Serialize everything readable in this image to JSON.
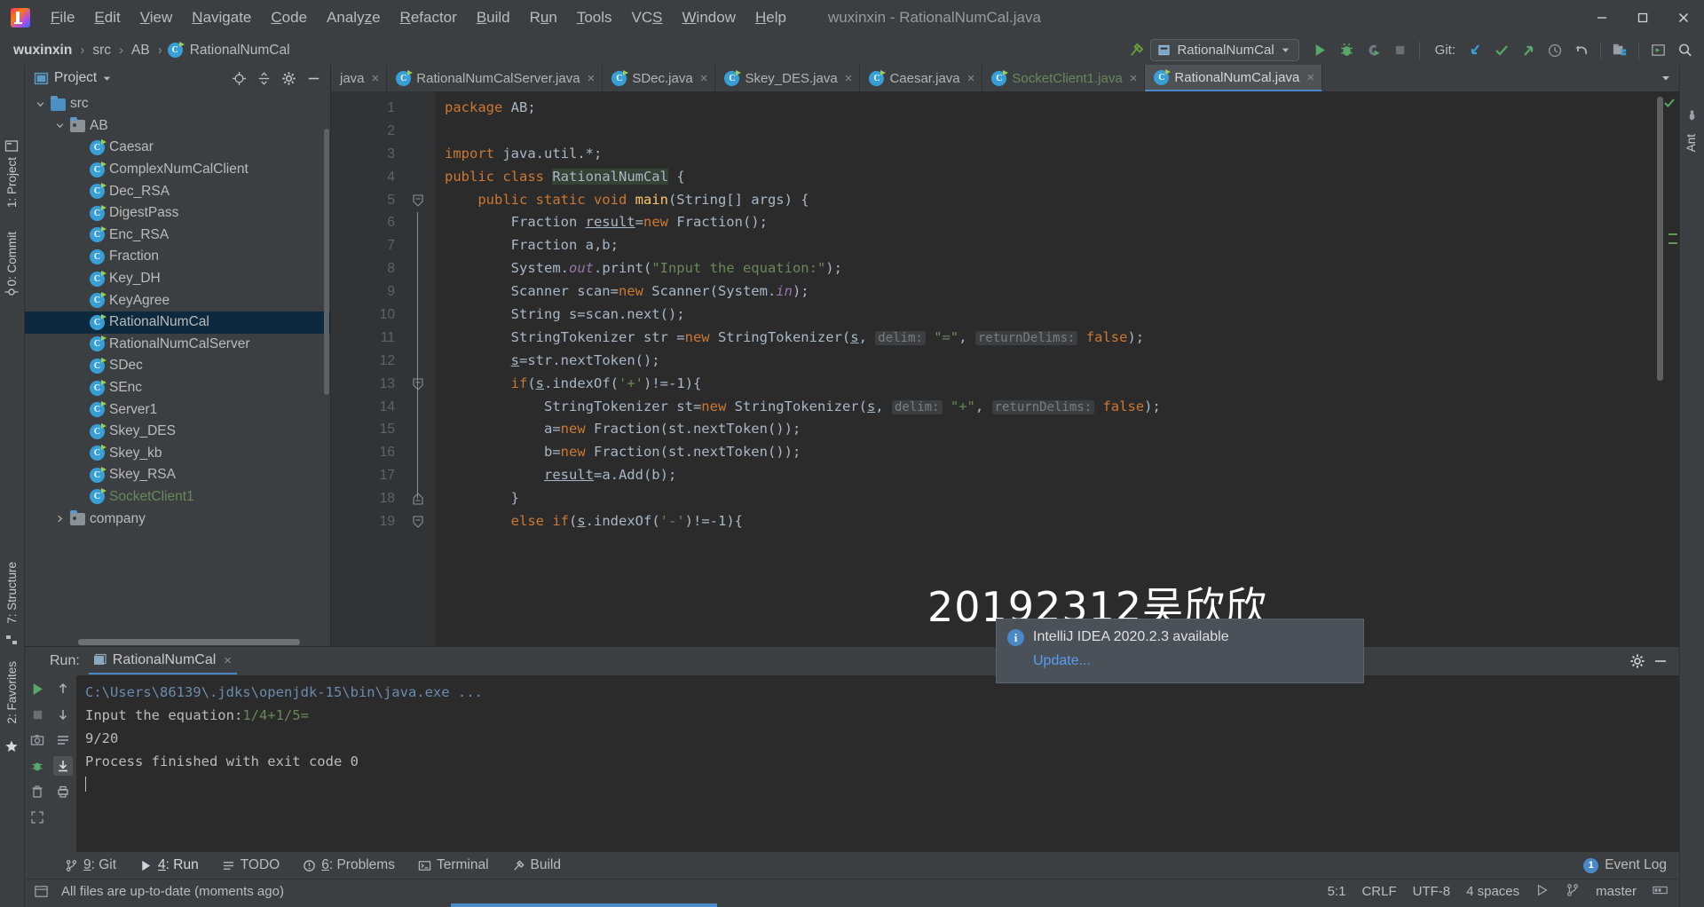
{
  "window": {
    "title": "wuxinxin - RationalNumCal.java",
    "logo": "intellij-idea-logo",
    "controls": {
      "minimize": "minimize-icon",
      "maximize": "maximize-icon",
      "close": "close-icon"
    }
  },
  "menubar": {
    "items": [
      {
        "label": "File",
        "accel": "F"
      },
      {
        "label": "Edit",
        "accel": "E"
      },
      {
        "label": "View",
        "accel": "V"
      },
      {
        "label": "Navigate",
        "accel": "N"
      },
      {
        "label": "Code",
        "accel": "C"
      },
      {
        "label": "Analyze",
        "accel": "z"
      },
      {
        "label": "Refactor",
        "accel": "R"
      },
      {
        "label": "Build",
        "accel": "B"
      },
      {
        "label": "Run",
        "accel": "u"
      },
      {
        "label": "Tools",
        "accel": "T"
      },
      {
        "label": "VCS",
        "accel": "S"
      },
      {
        "label": "Window",
        "accel": "W"
      },
      {
        "label": "Help",
        "accel": "H"
      }
    ]
  },
  "navbar": {
    "breadcrumbs": [
      "wuxinxin",
      "src",
      "AB",
      "RationalNumCal"
    ],
    "separator": "›",
    "run_configuration": "RationalNumCal",
    "git_label": "Git:",
    "icons": [
      "build-hammer-icon",
      "run-icon",
      "debug-icon",
      "run-with-coverage-icon",
      "stop-icon",
      "update-project-icon",
      "commit-icon",
      "push-icon",
      "history-icon",
      "rollback-icon",
      "project-structure-icon",
      "select-target-icon",
      "search-everywhere-icon"
    ]
  },
  "left_rail": {
    "items": [
      "1: Project",
      "0: Commit"
    ],
    "bottom_items": [
      "2: Favorites",
      "7: Structure"
    ]
  },
  "project_panel": {
    "title": "Project",
    "head_icons": [
      "locate-icon",
      "collapse-all-icon",
      "settings-gear-icon",
      "hide-icon"
    ],
    "tree": [
      {
        "label": "src",
        "indent": 1,
        "type": "folder-src",
        "expanded": true,
        "selected": false
      },
      {
        "label": "AB",
        "indent": 2,
        "type": "folder-pkg",
        "expanded": true,
        "selected": false
      },
      {
        "label": "Caesar",
        "indent": 3,
        "type": "class-badge",
        "selected": false
      },
      {
        "label": "ComplexNumCalClient",
        "indent": 3,
        "type": "class-badge",
        "selected": false
      },
      {
        "label": "Dec_RSA",
        "indent": 3,
        "type": "class-badge",
        "selected": false
      },
      {
        "label": "DigestPass",
        "indent": 3,
        "type": "class-badge",
        "selected": false
      },
      {
        "label": "Enc_RSA",
        "indent": 3,
        "type": "class-badge",
        "selected": false
      },
      {
        "label": "Fraction",
        "indent": 3,
        "type": "class",
        "selected": false
      },
      {
        "label": "Key_DH",
        "indent": 3,
        "type": "class-badge",
        "selected": false
      },
      {
        "label": "KeyAgree",
        "indent": 3,
        "type": "class-badge",
        "selected": false
      },
      {
        "label": "RationalNumCal",
        "indent": 3,
        "type": "class-badge",
        "selected": true
      },
      {
        "label": "RationalNumCalServer",
        "indent": 3,
        "type": "class-badge",
        "selected": false
      },
      {
        "label": "SDec",
        "indent": 3,
        "type": "class-badge",
        "selected": false
      },
      {
        "label": "SEnc",
        "indent": 3,
        "type": "class-badge",
        "selected": false
      },
      {
        "label": "Server1",
        "indent": 3,
        "type": "class-badge",
        "selected": false
      },
      {
        "label": "Skey_DES",
        "indent": 3,
        "type": "class-badge",
        "selected": false
      },
      {
        "label": "Skey_kb",
        "indent": 3,
        "type": "class-badge",
        "selected": false
      },
      {
        "label": "Skey_RSA",
        "indent": 3,
        "type": "class-badge",
        "selected": false
      },
      {
        "label": "SocketClient1",
        "indent": 3,
        "type": "class-badge",
        "selected": false,
        "green": true
      },
      {
        "label": "company",
        "indent": 2,
        "type": "folder-pkg",
        "expanded": false,
        "selected": false
      }
    ]
  },
  "editor": {
    "tabs": [
      {
        "label": "java",
        "icon": "none",
        "active": false,
        "green": false
      },
      {
        "label": "RationalNumCalServer.java",
        "icon": "java-class",
        "active": false,
        "green": false
      },
      {
        "label": "SDec.java",
        "icon": "java-class",
        "active": false,
        "green": false
      },
      {
        "label": "Skey_DES.java",
        "icon": "java-class",
        "active": false,
        "green": false
      },
      {
        "label": "Caesar.java",
        "icon": "java-class",
        "active": false,
        "green": false
      },
      {
        "label": "SocketClient1.java",
        "icon": "java-class",
        "active": false,
        "green": true
      },
      {
        "label": "RationalNumCal.java",
        "icon": "java-class",
        "active": true,
        "green": false
      }
    ],
    "line_numbers": [
      1,
      2,
      3,
      4,
      5,
      6,
      7,
      8,
      9,
      10,
      11,
      12,
      13,
      14,
      15,
      16,
      17,
      18,
      19
    ],
    "gutter_run_markers": [
      4,
      5
    ],
    "lines": [
      {
        "n": 1,
        "tokens": [
          {
            "t": "package ",
            "c": "kw"
          },
          {
            "t": "AB;",
            "c": ""
          }
        ]
      },
      {
        "n": 2,
        "tokens": []
      },
      {
        "n": 3,
        "tokens": [
          {
            "t": "import ",
            "c": "kw"
          },
          {
            "t": "java.util.*;",
            "c": ""
          }
        ]
      },
      {
        "n": 4,
        "tokens": [
          {
            "t": "public class ",
            "c": "kw"
          },
          {
            "t": "RationalNumCal",
            "c": "cls-hl"
          },
          {
            "t": " {",
            "c": ""
          }
        ]
      },
      {
        "n": 5,
        "tokens": [
          {
            "t": "    ",
            "c": ""
          },
          {
            "t": "public static void ",
            "c": "kw"
          },
          {
            "t": "main",
            "c": "mth"
          },
          {
            "t": "(String[] args) {",
            "c": ""
          }
        ]
      },
      {
        "n": 6,
        "tokens": [
          {
            "t": "        Fraction ",
            "c": ""
          },
          {
            "t": "result",
            "c": "und"
          },
          {
            "t": "=",
            "c": ""
          },
          {
            "t": "new ",
            "c": "kw"
          },
          {
            "t": "Fraction();",
            "c": ""
          }
        ]
      },
      {
        "n": 7,
        "tokens": [
          {
            "t": "        Fraction a,b;",
            "c": ""
          }
        ]
      },
      {
        "n": 8,
        "tokens": [
          {
            "t": "        System.",
            "c": ""
          },
          {
            "t": "out",
            "c": "fld"
          },
          {
            "t": ".print(",
            "c": ""
          },
          {
            "t": "\"Input the equation:\"",
            "c": "str"
          },
          {
            "t": ");",
            "c": ""
          }
        ]
      },
      {
        "n": 9,
        "tokens": [
          {
            "t": "        Scanner scan=",
            "c": ""
          },
          {
            "t": "new ",
            "c": "kw"
          },
          {
            "t": "Scanner(System.",
            "c": ""
          },
          {
            "t": "in",
            "c": "fld"
          },
          {
            "t": ");",
            "c": ""
          }
        ]
      },
      {
        "n": 10,
        "tokens": [
          {
            "t": "        String s=scan.next();",
            "c": ""
          }
        ]
      },
      {
        "n": 11,
        "tokens": [
          {
            "t": "        StringTokenizer str =",
            "c": ""
          },
          {
            "t": "new ",
            "c": "kw"
          },
          {
            "t": "StringTokenizer(",
            "c": ""
          },
          {
            "t": "s",
            "c": "und"
          },
          {
            "t": ", ",
            "c": ""
          },
          {
            "t": "delim:",
            "c": "hint"
          },
          {
            "t": " ",
            "c": ""
          },
          {
            "t": "\"=\"",
            "c": "str"
          },
          {
            "t": ", ",
            "c": ""
          },
          {
            "t": "returnDelims:",
            "c": "hint"
          },
          {
            "t": " ",
            "c": ""
          },
          {
            "t": "false",
            "c": "kw"
          },
          {
            "t": ");",
            "c": ""
          }
        ]
      },
      {
        "n": 12,
        "tokens": [
          {
            "t": "        ",
            "c": ""
          },
          {
            "t": "s",
            "c": "und"
          },
          {
            "t": "=str.nextToken();",
            "c": ""
          }
        ]
      },
      {
        "n": 13,
        "tokens": [
          {
            "t": "        ",
            "c": ""
          },
          {
            "t": "if",
            "c": "kw"
          },
          {
            "t": "(",
            "c": ""
          },
          {
            "t": "s",
            "c": "und"
          },
          {
            "t": ".indexOf(",
            "c": ""
          },
          {
            "t": "'+'",
            "c": "str"
          },
          {
            "t": ")!=-",
            "c": ""
          },
          {
            "t": "1",
            "c": ""
          },
          {
            "t": "){",
            "c": ""
          }
        ]
      },
      {
        "n": 14,
        "tokens": [
          {
            "t": "            StringTokenizer st=",
            "c": ""
          },
          {
            "t": "new ",
            "c": "kw"
          },
          {
            "t": "StringTokenizer(",
            "c": ""
          },
          {
            "t": "s",
            "c": "und"
          },
          {
            "t": ", ",
            "c": ""
          },
          {
            "t": "delim:",
            "c": "hint"
          },
          {
            "t": " ",
            "c": ""
          },
          {
            "t": "\"+\"",
            "c": "str"
          },
          {
            "t": ", ",
            "c": ""
          },
          {
            "t": "returnDelims:",
            "c": "hint"
          },
          {
            "t": " ",
            "c": ""
          },
          {
            "t": "false",
            "c": "kw"
          },
          {
            "t": ");",
            "c": ""
          }
        ]
      },
      {
        "n": 15,
        "tokens": [
          {
            "t": "            a=",
            "c": ""
          },
          {
            "t": "new ",
            "c": "kw"
          },
          {
            "t": "Fraction(st.nextToken());",
            "c": ""
          }
        ]
      },
      {
        "n": 16,
        "tokens": [
          {
            "t": "            b=",
            "c": ""
          },
          {
            "t": "new ",
            "c": "kw"
          },
          {
            "t": "Fraction(st.nextToken());",
            "c": ""
          }
        ]
      },
      {
        "n": 17,
        "tokens": [
          {
            "t": "            ",
            "c": ""
          },
          {
            "t": "result",
            "c": "und"
          },
          {
            "t": "=a.Add(b);",
            "c": ""
          }
        ]
      },
      {
        "n": 18,
        "tokens": [
          {
            "t": "        }",
            "c": ""
          }
        ]
      },
      {
        "n": 19,
        "tokens": [
          {
            "t": "        ",
            "c": ""
          },
          {
            "t": "else if",
            "c": "kw"
          },
          {
            "t": "(",
            "c": ""
          },
          {
            "t": "s",
            "c": "und"
          },
          {
            "t": ".indexOf(",
            "c": ""
          },
          {
            "t": "'-'",
            "c": "str"
          },
          {
            "t": ")!=-",
            "c": ""
          },
          {
            "t": "1",
            "c": ""
          },
          {
            "t": "){",
            "c": ""
          }
        ]
      }
    ]
  },
  "run_panel": {
    "head_label": "Run:",
    "tab_label": "RationalNumCal",
    "tab_close": "×",
    "head_icons": [
      "settings-gear-icon",
      "hide-icon"
    ],
    "side_icons": [
      "rerun-icon",
      "stop-icon",
      "screenshot-icon",
      "debug-icon",
      "trash-icon",
      "expand-icon"
    ],
    "side2_icons": [
      "scroll-up-icon",
      "scroll-down-icon",
      "soft-wrap-icon",
      "scroll-to-end-icon",
      "print-icon"
    ],
    "console": [
      {
        "text": "C:\\Users\\86139\\.jdks\\openjdk-15\\bin\\java.exe ...",
        "type": "cmd"
      },
      {
        "text": "Input the equation:",
        "suffix": "1/4+1/5=",
        "type": "prompt"
      },
      {
        "text": "9/20",
        "type": "out"
      },
      {
        "text": "Process finished with exit code 0",
        "type": "out"
      },
      {
        "text": "",
        "type": "caret"
      }
    ]
  },
  "watermark": {
    "text": "20192312吴欣欣"
  },
  "notification": {
    "icon": "info-icon",
    "title": "IntelliJ IDEA 2020.2.3 available",
    "link": "Update..."
  },
  "bottom_tabs": {
    "items": [
      {
        "label": "9: Git",
        "accel": "9",
        "icon": "git-branch-icon",
        "active": false
      },
      {
        "label": "4: Run",
        "accel": "4",
        "icon": "run-icon",
        "active": true
      },
      {
        "label": "TODO",
        "accel": "",
        "icon": "todo-icon",
        "active": false
      },
      {
        "label": "6: Problems",
        "accel": "6",
        "icon": "problems-icon",
        "active": false
      },
      {
        "label": "Terminal",
        "accel": "",
        "icon": "terminal-icon",
        "active": false
      },
      {
        "label": "Build",
        "accel": "",
        "icon": "build-hammer-icon",
        "active": false
      }
    ],
    "event_log": {
      "label": "Event Log",
      "count": "1"
    }
  },
  "statusbar": {
    "message": "All files are up-to-date (moments ago)",
    "icon": "sync-icon",
    "right_items": [
      {
        "label": "5:1",
        "name": "caret-position"
      },
      {
        "label": "CRLF",
        "name": "line-separator"
      },
      {
        "label": "UTF-8",
        "name": "file-encoding"
      },
      {
        "label": "4 spaces",
        "name": "indent-size"
      },
      {
        "label": "",
        "name": "read-only-toggle-icon"
      },
      {
        "label": "master",
        "name": "git-branch"
      },
      {
        "label": "",
        "name": "memory-indicator-icon"
      }
    ]
  },
  "colors": {
    "accent": "#4a88c7",
    "panel_bg": "#3c3f41",
    "editor_bg": "#2b2b2b",
    "gutter_bg": "#313335",
    "selection": "#0d293e",
    "keyword": "#cc7832",
    "string": "#6a8759",
    "field": "#9876aa",
    "method": "#ffc66d",
    "text": "#a9b7c6",
    "link": "#589df6"
  }
}
